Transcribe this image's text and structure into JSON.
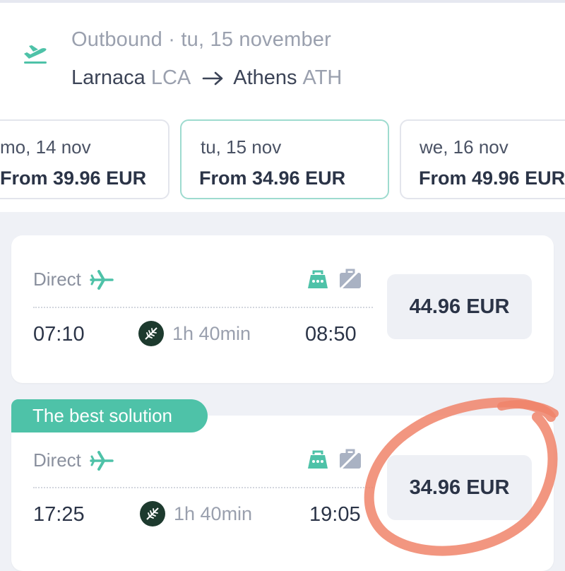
{
  "header": {
    "label": "Outbound",
    "separator": "·",
    "date": "tu, 15 november",
    "origin_city": "Larnaca",
    "origin_code": "LCA",
    "destination_city": "Athens",
    "destination_code": "ATH",
    "icon": "plane-departure-icon"
  },
  "dates": [
    {
      "day": "mo, 14 nov",
      "price": "From 39.96 EUR",
      "selected": false
    },
    {
      "day": "tu, 15 nov",
      "price": "From 34.96 EUR",
      "selected": true
    },
    {
      "day": "we, 16 nov",
      "price": "From 49.96 EUR",
      "selected": false
    }
  ],
  "flights": [
    {
      "type": "Direct",
      "depart": "07:10",
      "duration": "1h 40min",
      "arrive": "08:50",
      "price": "44.96 EUR"
    },
    {
      "badge": "The best solution",
      "type": "Direct",
      "depart": "17:25",
      "duration": "1h 40min",
      "arrive": "19:05",
      "price": "34.96 EUR"
    }
  ],
  "colors": {
    "accent": "#4ec2a8",
    "text": "#2b3447",
    "muted": "#9aa0ae",
    "annotation": "#f0846a"
  }
}
